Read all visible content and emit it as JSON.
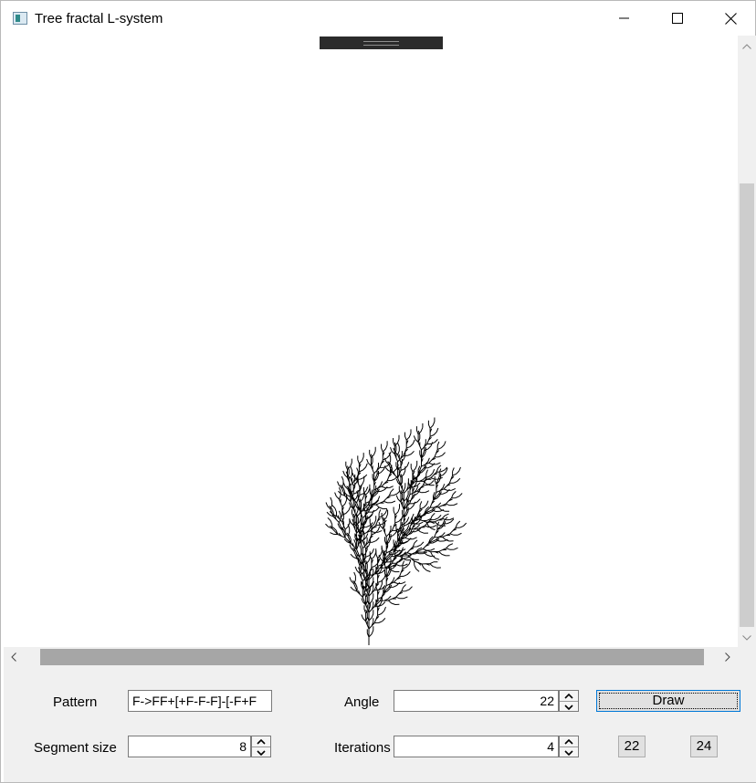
{
  "window": {
    "title": "Tree fractal L-system",
    "icon": "app-window-icon",
    "controls": [
      "minimize-icon",
      "maximize-icon",
      "close-icon"
    ]
  },
  "controls": {
    "pattern_label": "Pattern",
    "pattern_value": "F->FF+[+F-F-F]-[-F+F",
    "angle_label": "Angle",
    "angle_value": "22",
    "draw_label": "Draw",
    "segment_label": "Segment size",
    "segment_value": "8",
    "iterations_label": "Iterations",
    "iterations_value": "4",
    "preset_1": "22",
    "preset_2": "24"
  },
  "colors": {
    "stroke": "#000000",
    "panel": "#f0f0f0",
    "accent": "#0078d7"
  }
}
